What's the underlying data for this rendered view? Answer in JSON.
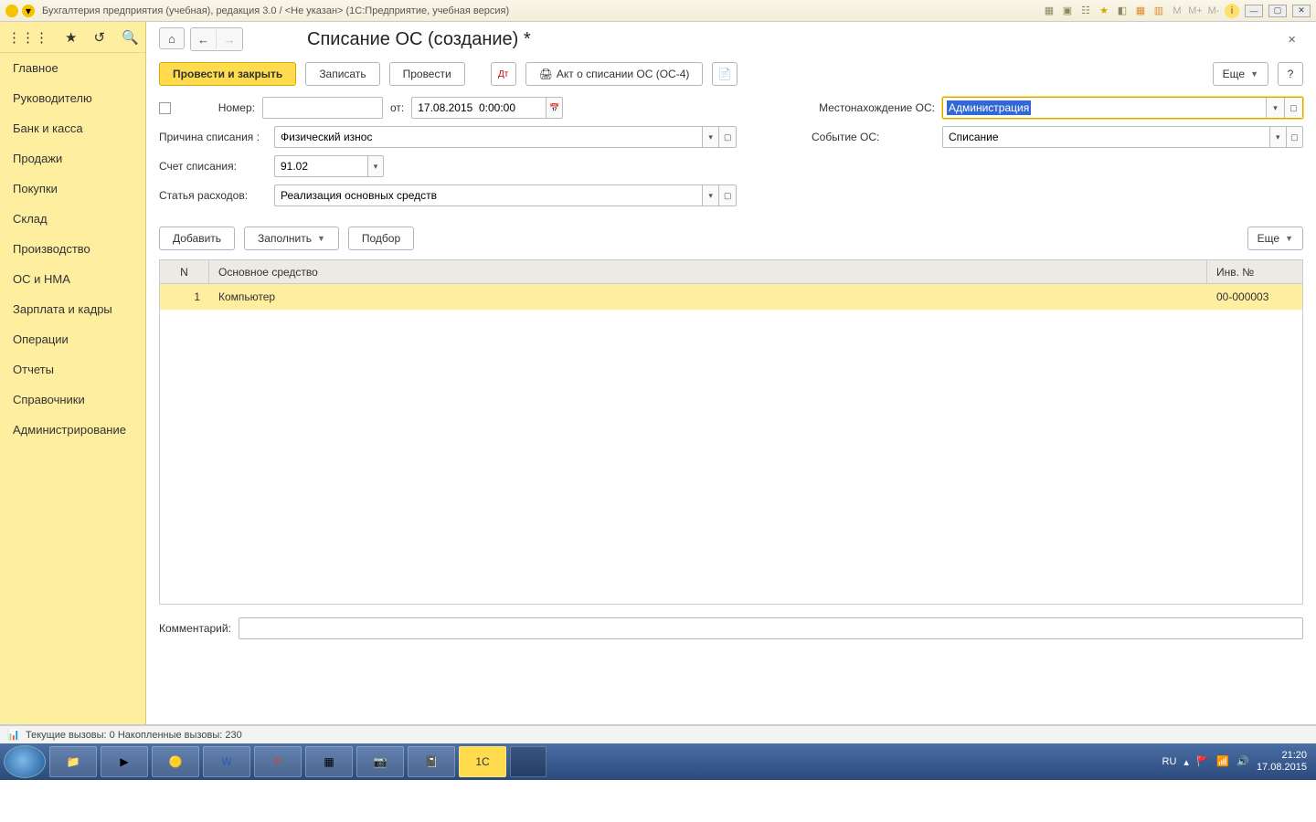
{
  "window": {
    "title": "Бухгалтерия предприятия (учебная), редакция 3.0 / <Не указан>  (1С:Предприятие, учебная версия)",
    "memory_labels": [
      "M",
      "M+",
      "M-"
    ]
  },
  "sidebar": {
    "items": [
      "Главное",
      "Руководителю",
      "Банк и касса",
      "Продажи",
      "Покупки",
      "Склад",
      "Производство",
      "ОС и НМА",
      "Зарплата и кадры",
      "Операции",
      "Отчеты",
      "Справочники",
      "Администрирование"
    ]
  },
  "page": {
    "title": "Списание ОС (создание) *"
  },
  "toolbar": {
    "post_close": "Провести и закрыть",
    "save": "Записать",
    "post": "Провести",
    "print_act": "Акт о списании ОС (ОС-4)",
    "more": "Еще"
  },
  "form": {
    "number_label": "Номер:",
    "number_value": "",
    "from_label": "от:",
    "date_value": "17.08.2015  0:00:00",
    "location_label": "Местонахождение ОС:",
    "location_value": "Администрация",
    "reason_label": "Причина списания :",
    "reason_value": "Физический износ",
    "event_label": "Событие ОС:",
    "event_value": "Списание",
    "account_label": "Счет списания:",
    "account_value": "91.02",
    "expense_label": "Статья расходов:",
    "expense_value": "Реализация основных средств"
  },
  "tabletools": {
    "add": "Добавить",
    "fill": "Заполнить",
    "pick": "Подбор",
    "more": "Еще"
  },
  "table": {
    "cols": {
      "n": "N",
      "asset": "Основное средство",
      "inv": "Инв. №"
    },
    "rows": [
      {
        "n": "1",
        "asset": "Компьютер",
        "inv": "00-000003"
      }
    ]
  },
  "comment": {
    "label": "Комментарий:",
    "value": ""
  },
  "status": {
    "text": "Текущие вызовы: 0   Накопленные вызовы: 230"
  },
  "tray": {
    "lang": "RU",
    "time": "21:20",
    "date": "17.08.2015"
  }
}
